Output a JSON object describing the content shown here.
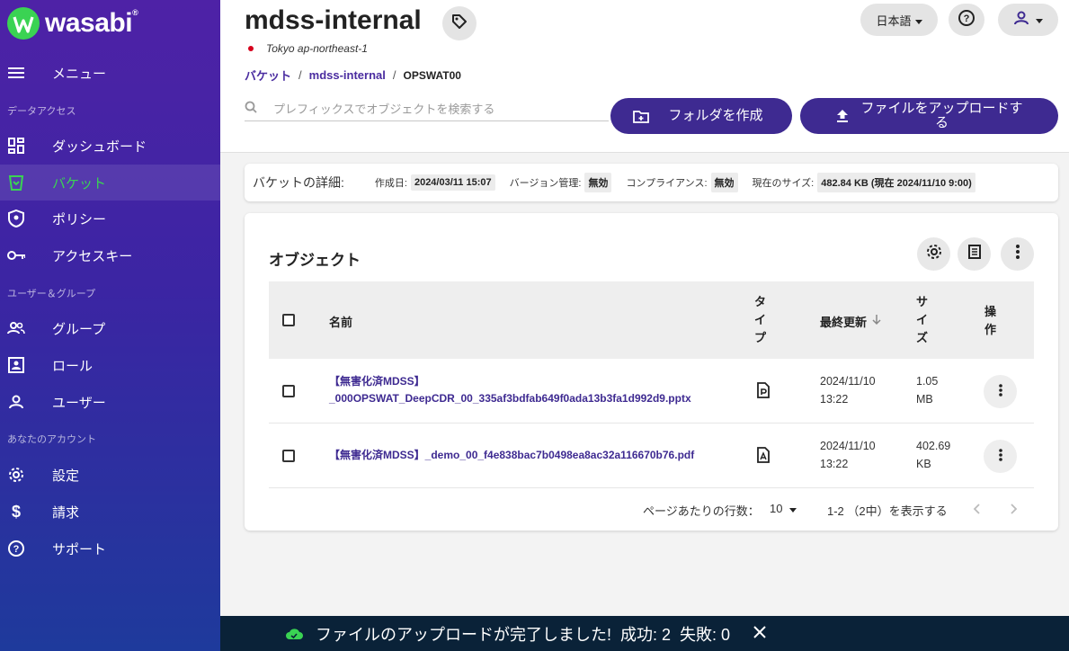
{
  "brand": {
    "name": "wasabi",
    "tm": "®"
  },
  "colors": {
    "accent": "#3e2a91",
    "green": "#3ad353",
    "sidebar": "#4e22a6",
    "toast": "#0a2238"
  },
  "sidebar": {
    "menu_label": "メニュー",
    "sections": {
      "data_access": "データアクセス",
      "users_groups": "ユーザー＆グループ",
      "account": "あなたのアカウント"
    },
    "items": [
      {
        "label": "ダッシュボード",
        "icon": "dashboard-icon"
      },
      {
        "label": "バケット",
        "icon": "bucket-icon",
        "active": true
      },
      {
        "label": "ポリシー",
        "icon": "policy-icon"
      },
      {
        "label": "アクセスキー",
        "icon": "key-icon"
      },
      {
        "label": "グループ",
        "icon": "group-icon"
      },
      {
        "label": "ロール",
        "icon": "role-icon"
      },
      {
        "label": "ユーザー",
        "icon": "user-icon"
      },
      {
        "label": "設定",
        "icon": "gear-icon"
      },
      {
        "label": "請求",
        "icon": "dollar-icon"
      },
      {
        "label": "サポート",
        "icon": "help-icon"
      }
    ]
  },
  "header": {
    "title": "mdss-internal",
    "region": "Tokyo ap-northeast-1",
    "breadcrumb": {
      "root": "バケット",
      "bucket": "mdss-internal",
      "current": "OPSWAT00"
    },
    "language": "日本語"
  },
  "search": {
    "placeholder": "プレフィックスでオブジェクトを検索する"
  },
  "actions": {
    "create_folder": "フォルダを作成",
    "upload_files": "ファイルをアップロードする"
  },
  "details": {
    "heading": "バケットの詳細:",
    "created_label": "作成日:",
    "created_value": "2024/03/11 15:07",
    "versioning_label": "バージョン管理:",
    "versioning_value": "無効",
    "compliance_label": "コンプライアンス:",
    "compliance_value": "無効",
    "size_label": "現在のサイズ:",
    "size_value": "482.84 KB (現在 2024/11/10 9:00)"
  },
  "objects": {
    "title": "オブジェクト",
    "columns": {
      "name": "名前",
      "type": "タイプ",
      "modified": "最終更新",
      "size": "サイズ",
      "actions": "操作"
    },
    "rows": [
      {
        "name_line1": "【無害化済MDSS】",
        "name_line2": "_000OPSWAT_DeepCDR_00_335af3bdfab649f0ada13b3fa1d992d9.pptx",
        "type_icon": "pptx-file-icon",
        "date": "2024/11/10",
        "time": "13:22",
        "size_value": "1.05",
        "size_unit": "MB"
      },
      {
        "name_line1": "【無害化済MDSS】_demo_00_f4e838bac7b0498ea8ac32a116670b76.pdf",
        "name_line2": "",
        "type_icon": "pdf-file-icon",
        "date": "2024/11/10",
        "time": "13:22",
        "size_value": "402.69",
        "size_unit": "KB"
      }
    ],
    "pagination": {
      "rows_per_page_label": "ページあたりの行数：",
      "rows_per_page": "10",
      "range_text": "1-2 （2中）を表示する"
    }
  },
  "toast": {
    "message": "ファイルのアップロードが完了しました!",
    "success": "成功: 2",
    "failure": "失敗: 0"
  }
}
